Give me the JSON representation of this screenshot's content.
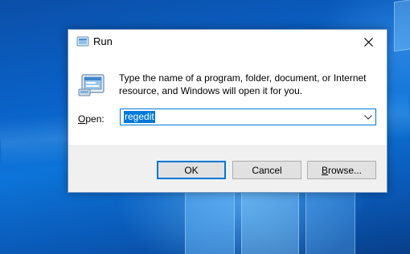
{
  "window": {
    "title": "Run",
    "close_label": "Close"
  },
  "content": {
    "description": "Type the name of a program, folder, document, or Internet resource, and Windows will open it for you.",
    "open_label_accel": "O",
    "open_label_rest": "pen:",
    "input_value": "regedit"
  },
  "buttons": {
    "ok": "OK",
    "cancel": "Cancel",
    "browse_accel": "B",
    "browse_rest": "rowse..."
  },
  "icons": {
    "title": "run-app-icon",
    "large": "run-app-icon",
    "close": "close-icon",
    "dropdown": "chevron-down-icon"
  },
  "colors": {
    "accent": "#0078d7",
    "desktop": "#0a63c9"
  }
}
